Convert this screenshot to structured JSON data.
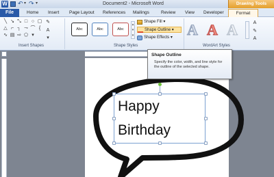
{
  "window": {
    "title": "Document2 - Microsoft Word",
    "app_icon": "W",
    "contextual_tab": "Drawing Tools"
  },
  "tabs": {
    "file": "File",
    "items": [
      "Home",
      "Insert",
      "Page Layout",
      "References",
      "Mailings",
      "Review",
      "View",
      "Developer"
    ],
    "active": "Format"
  },
  "ribbon": {
    "insert_shapes": {
      "label": "Insert Shapes",
      "icons": [
        "line",
        "arrow",
        "double-arrow",
        "rectangle",
        "oval",
        "rounded-rectangle",
        "triangle",
        "right-angle-line",
        "elbow-connector",
        "elbow-arrow",
        "curve",
        "freeform",
        "scribble",
        "text-box",
        "block-arrow",
        "pentagon",
        "edit-shape",
        "draw-textbox"
      ]
    },
    "shape_styles": {
      "label": "Shape Styles",
      "swatch_text": "Abc",
      "swatches": [
        {
          "border": "#222222",
          "fill": "#ffffff"
        },
        {
          "border": "#4f81bd",
          "fill": "#ffffff"
        },
        {
          "border": "#c0504d",
          "fill": "#ffffff"
        }
      ],
      "shape_fill": "Shape Fill",
      "shape_outline": "Shape Outline",
      "shape_effects": "Shape Effects"
    },
    "wordart": {
      "label": "WordArt Styles",
      "letter": "A",
      "colors": [
        "#c8d0dc",
        "#e8756f",
        "#dfe4ea"
      ]
    }
  },
  "tooltip": {
    "title": "Shape Outline",
    "description": "Specify the color, width, and line style for the outline of the selected shape."
  },
  "document": {
    "line1": "Happy",
    "line2": "Birthday"
  }
}
